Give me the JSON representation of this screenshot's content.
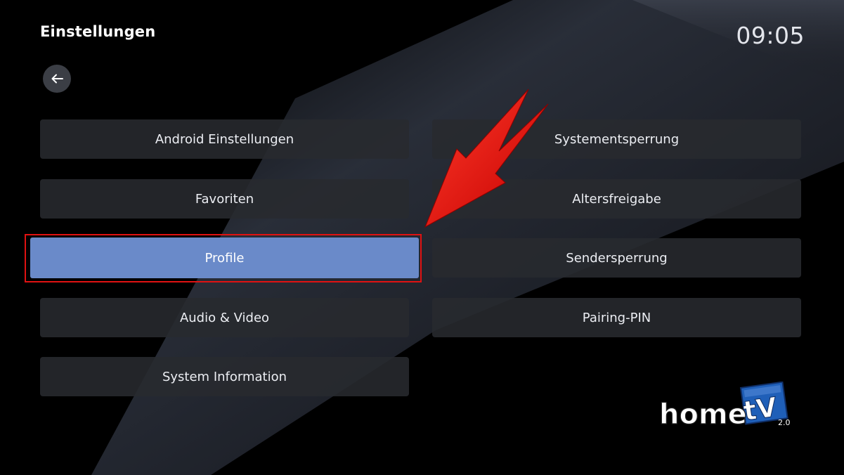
{
  "header": {
    "title": "Einstellungen",
    "clock": "09:05"
  },
  "menu": {
    "left": [
      {
        "label": "Android Einstellungen"
      },
      {
        "label": "Favoriten"
      },
      {
        "label": "Profile"
      },
      {
        "label": "Audio & Video"
      },
      {
        "label": "System Information"
      }
    ],
    "right": [
      {
        "label": "Systementsperrung"
      },
      {
        "label": "Altersfreigabe"
      },
      {
        "label": "Sendersperrung"
      },
      {
        "label": "Pairing-PIN"
      }
    ],
    "focused_item": "Profile"
  },
  "logo": {
    "text_home": "home",
    "text_tv": "tV",
    "text_version": "2.0"
  },
  "icons": {
    "back": "arrow-left-icon",
    "annotation": "red-arrow-icon"
  },
  "colors": {
    "background": "#000000",
    "tile": "#28292e",
    "focused_tile": "#6a8ac9",
    "annotation": "#e01212",
    "logo_blue": "#1f5fb8"
  }
}
